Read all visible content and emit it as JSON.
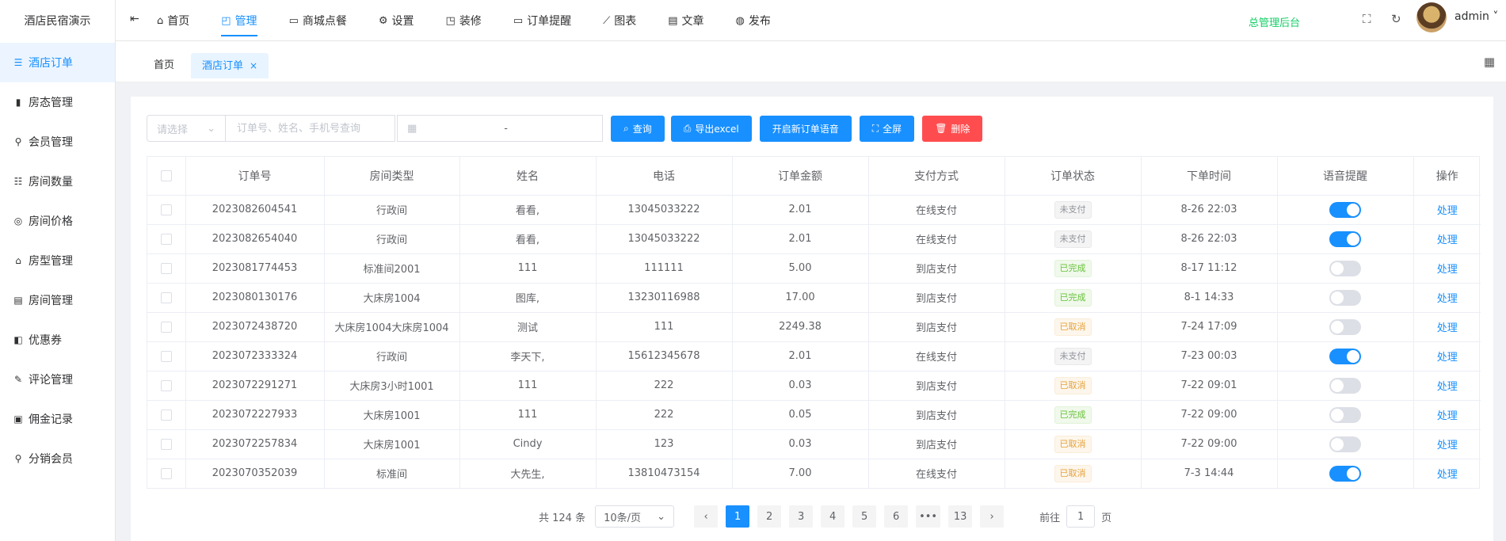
{
  "brand": "酒店民宿演示",
  "sidebar": {
    "items": [
      {
        "label": "酒店订单",
        "icon": "list-icon",
        "glyph": "☰",
        "active": true
      },
      {
        "label": "房态管理",
        "icon": "bar-chart-icon",
        "glyph": "▮",
        "active": false
      },
      {
        "label": "会员管理",
        "icon": "user-icon",
        "glyph": "⚲",
        "active": false
      },
      {
        "label": "房间数量",
        "icon": "list-icon",
        "glyph": "☷",
        "active": false
      },
      {
        "label": "房间价格",
        "icon": "price-icon",
        "glyph": "◎",
        "active": false
      },
      {
        "label": "房型管理",
        "icon": "bank-icon",
        "glyph": "⌂",
        "active": false
      },
      {
        "label": "房间管理",
        "icon": "building-icon",
        "glyph": "▤",
        "active": false
      },
      {
        "label": "优惠券",
        "icon": "coupon-icon",
        "glyph": "◧",
        "active": false
      },
      {
        "label": "评论管理",
        "icon": "edit-icon",
        "glyph": "✎",
        "active": false
      },
      {
        "label": "佣金记录",
        "icon": "wallet-icon",
        "glyph": "▣",
        "active": false
      },
      {
        "label": "分销会员",
        "icon": "user-icon",
        "glyph": "⚲",
        "active": false
      }
    ]
  },
  "header": {
    "nav": [
      {
        "label": "首页",
        "icon": "home-icon",
        "glyph": "⌂",
        "active": false
      },
      {
        "label": "管理",
        "icon": "manage-icon",
        "glyph": "◰",
        "active": true
      },
      {
        "label": "商城点餐",
        "icon": "chat-icon",
        "glyph": "▭",
        "active": false
      },
      {
        "label": "设置",
        "icon": "gear-icon",
        "glyph": "⚙",
        "active": false
      },
      {
        "label": "装修",
        "icon": "brush-icon",
        "glyph": "◳",
        "active": false
      },
      {
        "label": "订单提醒",
        "icon": "message-icon",
        "glyph": "▭",
        "active": false
      },
      {
        "label": "图表",
        "icon": "line-chart-icon",
        "glyph": "⟋",
        "active": false
      },
      {
        "label": "文章",
        "icon": "document-icon",
        "glyph": "▤",
        "active": false
      },
      {
        "label": "发布",
        "icon": "wechat-icon",
        "glyph": "◍",
        "active": false
      }
    ],
    "admin_center": "总管理后台",
    "user": "admin ˅"
  },
  "tags": {
    "home": "首页",
    "current": "酒店订单",
    "close": "×"
  },
  "filters": {
    "select_placeholder": "请选择",
    "search_placeholder": "订单号、姓名、手机号查询",
    "date_sep": "-",
    "buttons": {
      "query": "查询",
      "export": "导出excel",
      "voice": "开启新订单语音",
      "fullscreen": "全屏",
      "delete": "删除"
    }
  },
  "table": {
    "headers": [
      "订单号",
      "房间类型",
      "姓名",
      "电话",
      "订单金额",
      "支付方式",
      "订单状态",
      "下单时间",
      "语音提醒",
      "操作"
    ],
    "action_label": "处理",
    "rows": [
      {
        "order_no": "2023082604541",
        "room": "行政间",
        "name": "看看,",
        "phone": "13045033222",
        "amount": "2.01",
        "pay": "在线支付",
        "status": "未支付",
        "status_type": "unpaid",
        "time": "8-26 22:03",
        "voice": true
      },
      {
        "order_no": "2023082654040",
        "room": "行政间",
        "name": "看看,",
        "phone": "13045033222",
        "amount": "2.01",
        "pay": "在线支付",
        "status": "未支付",
        "status_type": "unpaid",
        "time": "8-26 22:03",
        "voice": true
      },
      {
        "order_no": "2023081774453",
        "room": "标准间2001",
        "name": "111",
        "phone": "111111",
        "amount": "5.00",
        "pay": "到店支付",
        "status": "已完成",
        "status_type": "done",
        "time": "8-17 11:12",
        "voice": false
      },
      {
        "order_no": "2023080130176",
        "room": "大床房1004",
        "name": "图库,",
        "phone": "13230116988",
        "amount": "17.00",
        "pay": "到店支付",
        "status": "已完成",
        "status_type": "done",
        "time": "8-1 14:33",
        "voice": false
      },
      {
        "order_no": "2023072438720",
        "room": "大床房1004大床房1004",
        "name": "测试",
        "phone": "111",
        "amount": "2249.38",
        "pay": "到店支付",
        "status": "已取消",
        "status_type": "cancel",
        "time": "7-24 17:09",
        "voice": false
      },
      {
        "order_no": "2023072333324",
        "room": "行政间",
        "name": "李天下,",
        "phone": "15612345678",
        "amount": "2.01",
        "pay": "在线支付",
        "status": "未支付",
        "status_type": "unpaid",
        "time": "7-23 00:03",
        "voice": true
      },
      {
        "order_no": "2023072291271",
        "room": "大床房3小时1001",
        "name": "111",
        "phone": "222",
        "amount": "0.03",
        "pay": "到店支付",
        "status": "已取消",
        "status_type": "cancel",
        "time": "7-22 09:01",
        "voice": false
      },
      {
        "order_no": "2023072227933",
        "room": "大床房1001",
        "name": "111",
        "phone": "222",
        "amount": "0.05",
        "pay": "到店支付",
        "status": "已完成",
        "status_type": "done",
        "time": "7-22 09:00",
        "voice": false
      },
      {
        "order_no": "2023072257834",
        "room": "大床房1001",
        "name": "Cindy",
        "phone": "123",
        "amount": "0.03",
        "pay": "到店支付",
        "status": "已取消",
        "status_type": "cancel",
        "time": "7-22 09:00",
        "voice": false
      },
      {
        "order_no": "2023070352039",
        "room": "标准间",
        "name": "大先生,",
        "phone": "13810473154",
        "amount": "7.00",
        "pay": "在线支付",
        "status": "已取消",
        "status_type": "cancel",
        "time": "7-3 14:44",
        "voice": true
      }
    ]
  },
  "pagination": {
    "total": "共 124 条",
    "page_size": "10条/页",
    "prev": "‹",
    "pages": [
      "1",
      "2",
      "3",
      "4",
      "5",
      "6"
    ],
    "more": "•••",
    "last": "13",
    "next": "›",
    "current": "1",
    "goto_prefix": "前往",
    "goto_value": "1",
    "goto_suffix": "页"
  },
  "colors": {
    "primary": "#1890ff",
    "danger": "#ff4d4f",
    "success": "#13ce66"
  }
}
